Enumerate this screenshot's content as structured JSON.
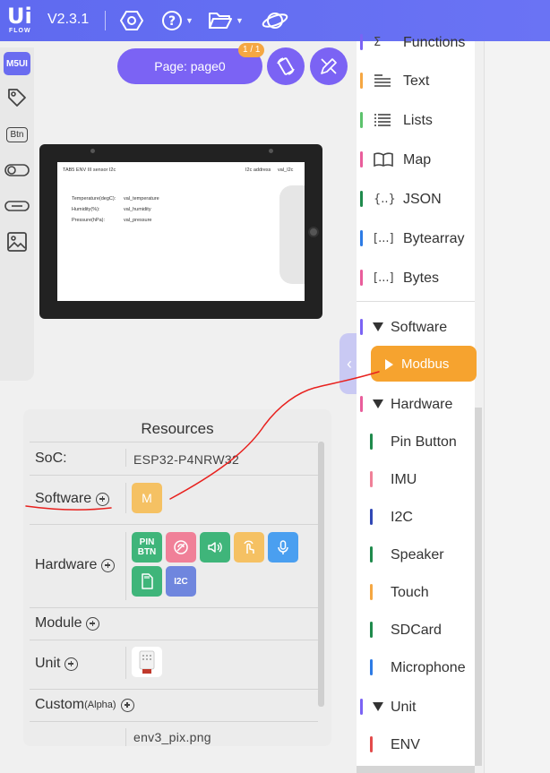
{
  "topbar": {
    "logo_big": "Ui",
    "logo_small": "FLOW",
    "version": "V2.3.1",
    "icons": [
      "settings-hex-icon",
      "help-icon",
      "folder-icon",
      "planet-icon"
    ]
  },
  "leftbar": {
    "items": [
      "M5UI",
      "tag-icon",
      "Btn",
      "switch-icon",
      "toggle-icon",
      "image-icon"
    ]
  },
  "page": {
    "label": "Page: page0",
    "badge": "1 / 1"
  },
  "device_screen": {
    "title": "TAB5 ENV III sensor I2c",
    "header_right_1": "I2c address",
    "header_right_2": "val_I2c",
    "rows": [
      {
        "label": "Temperature(degC):",
        "value": "val_temperature"
      },
      {
        "label": "Humidity(%):",
        "value": "val_humidity"
      },
      {
        "label": "Pressure(hPa):",
        "value": "val_pressure"
      }
    ]
  },
  "blocks": {
    "items": [
      {
        "label": "Functions",
        "icon": "sigma-icon",
        "color": "#7b63f4"
      },
      {
        "label": "Text",
        "icon": "text-icon",
        "color": "#f5a742"
      },
      {
        "label": "Lists",
        "icon": "list-icon",
        "color": "#5cc26c"
      },
      {
        "label": "Map",
        "icon": "book-icon",
        "color": "#e95d9b"
      },
      {
        "label": "JSON",
        "icon": "{..}",
        "color": "#1f8a4c"
      },
      {
        "label": "Bytearray",
        "icon": "[...]",
        "color": "#2d7be5"
      },
      {
        "label": "Bytes",
        "icon": "[...]",
        "color": "#e95d9b"
      }
    ],
    "software_label": "Software",
    "modbus_label": "Modbus",
    "hardware_label": "Hardware",
    "hardware_items": [
      {
        "label": "Pin Button",
        "color": "#1f8a4c"
      },
      {
        "label": "IMU",
        "color": "#f08098"
      },
      {
        "label": "I2C",
        "color": "#3148b5"
      },
      {
        "label": "Speaker",
        "color": "#1f8a4c"
      },
      {
        "label": "Touch",
        "color": "#f5a742"
      },
      {
        "label": "SDCard",
        "color": "#1f8a4c"
      },
      {
        "label": "Microphone",
        "color": "#2d7be5"
      }
    ],
    "unit_label": "Unit",
    "unit_items": [
      {
        "label": "ENV",
        "color": "#e34b4b"
      }
    ],
    "software_bar_color": "#7b63f4",
    "hardware_bar_color": "#e95d9b",
    "unit_bar_color": "#7b63f4"
  },
  "resources": {
    "title": "Resources",
    "soc_label": "SoC:",
    "soc_value": "ESP32-P4NRW32",
    "software_label": "Software",
    "software_chip": "M",
    "hardware_label": "Hardware",
    "hardware_chips": [
      {
        "label": "PIN BTN",
        "color": "#3fb57a"
      },
      {
        "label": "",
        "icon": "imu-icon",
        "color": "#f08098"
      },
      {
        "label": "",
        "icon": "speaker-icon",
        "color": "#3fb57a"
      },
      {
        "label": "",
        "icon": "touch-icon",
        "color": "#f5c163"
      },
      {
        "label": "",
        "icon": "microphone-icon",
        "color": "#4a9ff0"
      },
      {
        "label": "",
        "icon": "sdcard-icon",
        "color": "#3fb57a"
      },
      {
        "label": "I2C",
        "color": "#6f86de"
      }
    ],
    "module_label": "Module",
    "unit_label": "Unit",
    "custom_label": "Custom",
    "custom_suffix": "(Alpha)",
    "file_value": "env3_pix.png"
  },
  "colors": {
    "accent": "#7b63f4",
    "topbar": "#5f6af0",
    "modbus": "#f6a32f",
    "annotation": "#e8211e"
  }
}
